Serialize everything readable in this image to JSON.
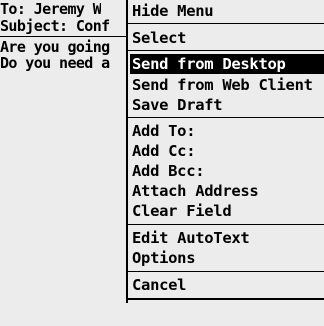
{
  "compose": {
    "to_line": "To: Jeremy W",
    "subject_line": "Subject: Conf",
    "body_line1": "Are you going",
    "body_line2": "Do you need a"
  },
  "menu": {
    "header": "Hide Menu",
    "group1": [
      "Select"
    ],
    "group2": [
      "Send from Desktop",
      "Send from Web Client",
      "Save Draft"
    ],
    "group3": [
      "Add To:",
      "Add Cc:",
      "Add Bcc:",
      "Attach Address",
      "Clear Field"
    ],
    "group4": [
      "Edit AutoText",
      "Options"
    ],
    "group5": [
      "Cancel"
    ],
    "selected_item": "Send from Desktop"
  }
}
